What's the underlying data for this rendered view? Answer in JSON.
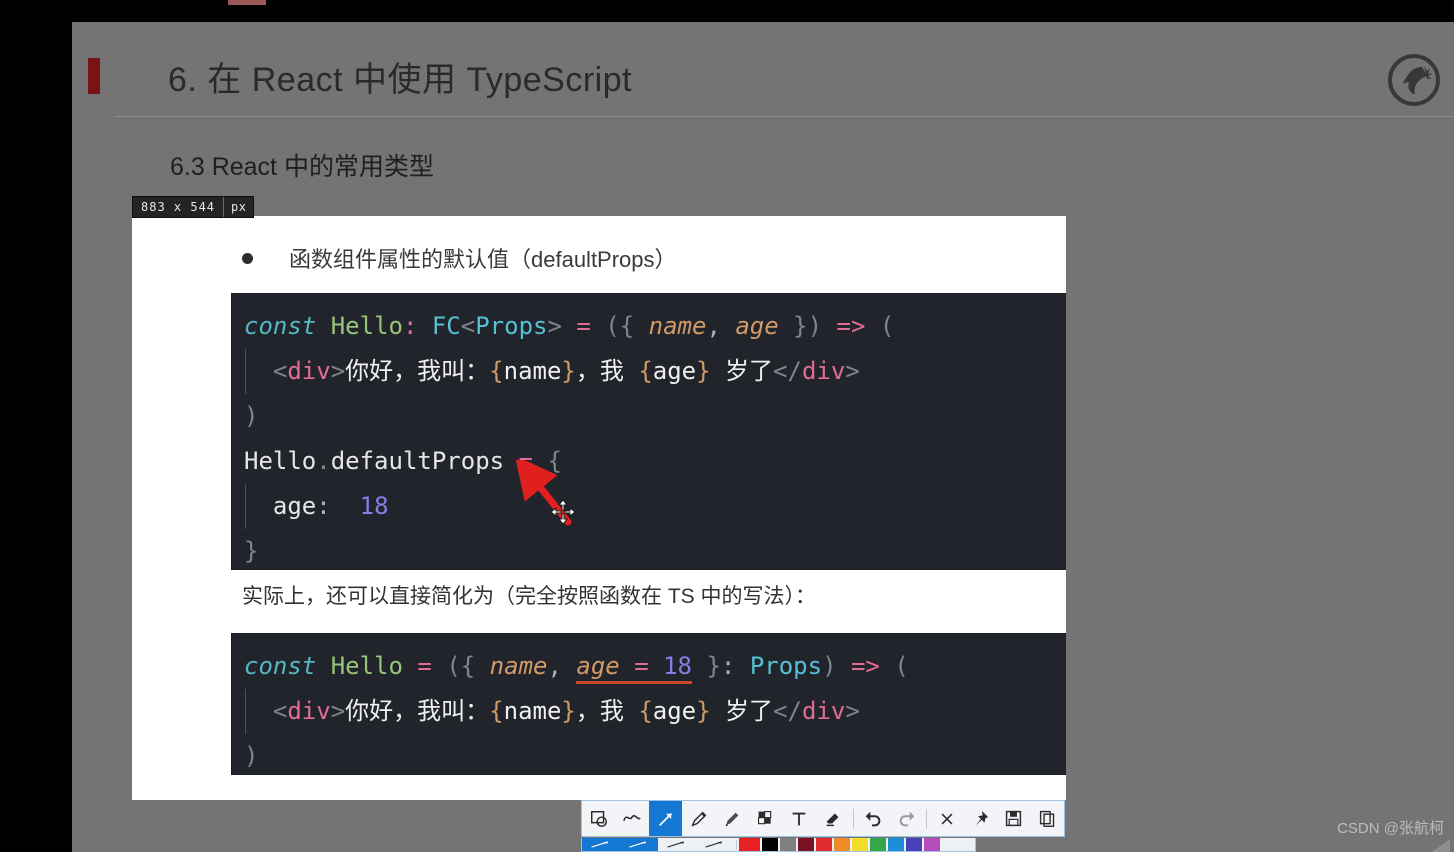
{
  "slide": {
    "title": "6. 在 React 中使用 TypeScript",
    "subtitle": "6.3 React 中的常用类型",
    "logo_icon": "horse-head-logo-icon"
  },
  "size_badge": {
    "dimensions": "883 x 544",
    "unit": "px"
  },
  "capture": {
    "bullet": {
      "marker_icon": "bullet-dot-icon",
      "text": "函数组件属性的默认值（defaultProps）"
    },
    "code_block_1": {
      "lines": [
        {
          "tokens": [
            {
              "t": "const",
              "c": "t-kw"
            },
            {
              "t": " ",
              "c": "t-plain"
            },
            {
              "t": "Hello",
              "c": "t-fn"
            },
            {
              "t": ":",
              "c": "t-op"
            },
            {
              "t": " ",
              "c": "t-plain"
            },
            {
              "t": "FC",
              "c": "t-type"
            },
            {
              "t": "<",
              "c": "t-bracket"
            },
            {
              "t": "Props",
              "c": "t-type"
            },
            {
              "t": ">",
              "c": "t-bracket"
            },
            {
              "t": " ",
              "c": "t-plain"
            },
            {
              "t": "=",
              "c": "t-op"
            },
            {
              "t": " ",
              "c": "t-plain"
            },
            {
              "t": "(",
              "c": "t-bracket"
            },
            {
              "t": "{",
              "c": "t-bracket"
            },
            {
              "t": " ",
              "c": "t-plain"
            },
            {
              "t": "name",
              "c": "t-param"
            },
            {
              "t": ",",
              "c": "t-punct"
            },
            {
              "t": " ",
              "c": "t-plain"
            },
            {
              "t": "age",
              "c": "t-param"
            },
            {
              "t": " ",
              "c": "t-plain"
            },
            {
              "t": "}",
              "c": "t-bracket"
            },
            {
              "t": ")",
              "c": "t-bracket"
            },
            {
              "t": " ",
              "c": "t-plain"
            },
            {
              "t": "=>",
              "c": "t-arrow"
            },
            {
              "t": " ",
              "c": "t-plain"
            },
            {
              "t": "(",
              "c": "t-bracket"
            }
          ]
        },
        {
          "indent": true,
          "tokens": [
            {
              "t": "  ",
              "c": "t-plain"
            },
            {
              "t": "<",
              "c": "t-bracket"
            },
            {
              "t": "div",
              "c": "t-tag"
            },
            {
              "t": ">",
              "c": "t-bracket"
            },
            {
              "t": "你好，我叫：",
              "c": "t-text"
            },
            {
              "t": "{",
              "c": "t-brace"
            },
            {
              "t": "name",
              "c": "t-text"
            },
            {
              "t": "}",
              "c": "t-brace"
            },
            {
              "t": "，我 ",
              "c": "t-text"
            },
            {
              "t": "{",
              "c": "t-brace"
            },
            {
              "t": "age",
              "c": "t-text"
            },
            {
              "t": "}",
              "c": "t-brace"
            },
            {
              "t": " 岁了",
              "c": "t-text"
            },
            {
              "t": "</",
              "c": "t-bracket"
            },
            {
              "t": "div",
              "c": "t-tag"
            },
            {
              "t": ">",
              "c": "t-bracket"
            }
          ]
        },
        {
          "tokens": [
            {
              "t": ")",
              "c": "t-bracket"
            }
          ]
        },
        {
          "tokens": [
            {
              "t": "Hello",
              "c": "t-plain"
            },
            {
              "t": ".",
              "c": "t-bracket"
            },
            {
              "t": "defaultProps",
              "c": "t-plain"
            },
            {
              "t": " ",
              "c": "t-plain"
            },
            {
              "t": "=",
              "c": "t-op"
            },
            {
              "t": " ",
              "c": "t-plain"
            },
            {
              "t": "{",
              "c": "t-bracket"
            }
          ]
        },
        {
          "indent": true,
          "tokens": [
            {
              "t": "  ",
              "c": "t-plain"
            },
            {
              "t": "age",
              "c": "t-plain"
            },
            {
              "t": ":",
              "c": "t-punct"
            },
            {
              "t": "  ",
              "c": "t-plain"
            },
            {
              "t": "18",
              "c": "t-num"
            }
          ]
        },
        {
          "tokens": [
            {
              "t": "}",
              "c": "t-bracket"
            }
          ]
        }
      ]
    },
    "mid_note": "实际上，还可以直接简化为（完全按照函数在 TS 中的写法）：",
    "code_block_2": {
      "lines": [
        {
          "tokens": [
            {
              "t": "const",
              "c": "t-kw"
            },
            {
              "t": " ",
              "c": "t-plain"
            },
            {
              "t": "Hello",
              "c": "t-fn"
            },
            {
              "t": " ",
              "c": "t-plain"
            },
            {
              "t": "=",
              "c": "t-op"
            },
            {
              "t": " ",
              "c": "t-plain"
            },
            {
              "t": "(",
              "c": "t-bracket"
            },
            {
              "t": "{",
              "c": "t-bracket"
            },
            {
              "t": " ",
              "c": "t-plain"
            },
            {
              "t": "name",
              "c": "t-param"
            },
            {
              "t": ",",
              "c": "t-punct"
            },
            {
              "t": " ",
              "c": "t-plain"
            },
            {
              "t": "age",
              "c": "t-param underline-red"
            },
            {
              "t": " ",
              "c": "t-plain underline-red"
            },
            {
              "t": "=",
              "c": "t-op underline-red"
            },
            {
              "t": " ",
              "c": "t-plain underline-red"
            },
            {
              "t": "18",
              "c": "t-num underline-red"
            },
            {
              "t": " ",
              "c": "t-plain"
            },
            {
              "t": "}",
              "c": "t-bracket"
            },
            {
              "t": ":",
              "c": "t-punct"
            },
            {
              "t": " ",
              "c": "t-plain"
            },
            {
              "t": "Props",
              "c": "t-type"
            },
            {
              "t": ")",
              "c": "t-bracket"
            },
            {
              "t": " ",
              "c": "t-plain"
            },
            {
              "t": "=>",
              "c": "t-arrow"
            },
            {
              "t": " ",
              "c": "t-plain"
            },
            {
              "t": "(",
              "c": "t-bracket"
            }
          ]
        },
        {
          "indent": true,
          "tokens": [
            {
              "t": "  ",
              "c": "t-plain"
            },
            {
              "t": "<",
              "c": "t-bracket"
            },
            {
              "t": "div",
              "c": "t-tag"
            },
            {
              "t": ">",
              "c": "t-bracket"
            },
            {
              "t": "你好，我叫：",
              "c": "t-text"
            },
            {
              "t": "{",
              "c": "t-brace"
            },
            {
              "t": "name",
              "c": "t-text"
            },
            {
              "t": "}",
              "c": "t-brace"
            },
            {
              "t": "，我 ",
              "c": "t-text"
            },
            {
              "t": "{",
              "c": "t-brace"
            },
            {
              "t": "age",
              "c": "t-text"
            },
            {
              "t": "}",
              "c": "t-brace"
            },
            {
              "t": " 岁了",
              "c": "t-text"
            },
            {
              "t": "</",
              "c": "t-bracket"
            },
            {
              "t": "div",
              "c": "t-tag"
            },
            {
              "t": ">",
              "c": "t-bracket"
            }
          ]
        },
        {
          "tokens": [
            {
              "t": ")",
              "c": "t-bracket"
            }
          ]
        }
      ]
    }
  },
  "annotation": {
    "arrow_color": "#e01f1f",
    "arrow_icon": "red-arrow-annotation-icon",
    "cursor_icon": "move-cursor-icon"
  },
  "toolbar": {
    "tools": [
      {
        "name": "rectangle-shape-tool",
        "icon": "rectangle-ellipse-icon",
        "active": false,
        "dim": false
      },
      {
        "name": "freehand-line-tool",
        "icon": "wave-line-icon",
        "active": false,
        "dim": false
      },
      {
        "name": "arrow-tool",
        "icon": "arrow-icon",
        "active": true,
        "dim": false
      },
      {
        "name": "pencil-tool",
        "icon": "pencil-icon",
        "active": false,
        "dim": false
      },
      {
        "name": "marker-tool",
        "icon": "highlighter-icon",
        "active": false,
        "dim": false
      },
      {
        "name": "mosaic-tool",
        "icon": "mosaic-checker-icon",
        "active": false,
        "dim": false
      },
      {
        "name": "text-tool",
        "icon": "text-t-icon",
        "active": false,
        "dim": false
      },
      {
        "name": "eraser-tool",
        "icon": "eraser-icon",
        "active": false,
        "dim": false
      },
      {
        "name": "divider-1",
        "icon": "divider-icon",
        "active": false,
        "dim": false
      },
      {
        "name": "undo-button",
        "icon": "undo-arrow-icon",
        "active": false,
        "dim": false
      },
      {
        "name": "redo-button",
        "icon": "redo-arrow-icon",
        "active": false,
        "dim": true
      },
      {
        "name": "divider-2",
        "icon": "divider-icon",
        "active": false,
        "dim": false
      },
      {
        "name": "close-button",
        "icon": "close-x-icon",
        "active": false,
        "dim": false
      },
      {
        "name": "pin-button",
        "icon": "pin-icon",
        "active": false,
        "dim": false
      },
      {
        "name": "save-button",
        "icon": "floppy-save-icon",
        "active": false,
        "dim": false
      },
      {
        "name": "copy-button",
        "icon": "copy-pages-icon",
        "active": false,
        "dim": false
      }
    ],
    "row2": {
      "arrow_styles": [
        {
          "name": "arrow-style-solid",
          "selected": true
        },
        {
          "name": "arrow-style-filled",
          "selected": true
        },
        {
          "name": "arrow-style-thin",
          "selected": false
        },
        {
          "name": "arrow-style-outline",
          "selected": false
        }
      ],
      "colors": [
        {
          "name": "color-red-selected",
          "hex": "#e81f24",
          "big": true
        },
        {
          "name": "color-black",
          "hex": "#000000",
          "big": false
        },
        {
          "name": "color-gray",
          "hex": "#808080",
          "big": false
        },
        {
          "name": "color-dark-red",
          "hex": "#7a1022",
          "big": false
        },
        {
          "name": "color-red",
          "hex": "#e02b30",
          "big": false
        },
        {
          "name": "color-orange",
          "hex": "#f08b2b",
          "big": false
        },
        {
          "name": "color-yellow",
          "hex": "#f2dd2a",
          "big": false
        },
        {
          "name": "color-green",
          "hex": "#35a74a",
          "big": false
        },
        {
          "name": "color-blue",
          "hex": "#1b8fd6",
          "big": false
        },
        {
          "name": "color-indigo",
          "hex": "#4941ba",
          "big": false
        },
        {
          "name": "color-magenta",
          "hex": "#b64bbd",
          "big": false
        }
      ]
    }
  },
  "watermark": {
    "text": "CSDN @张航柯"
  }
}
